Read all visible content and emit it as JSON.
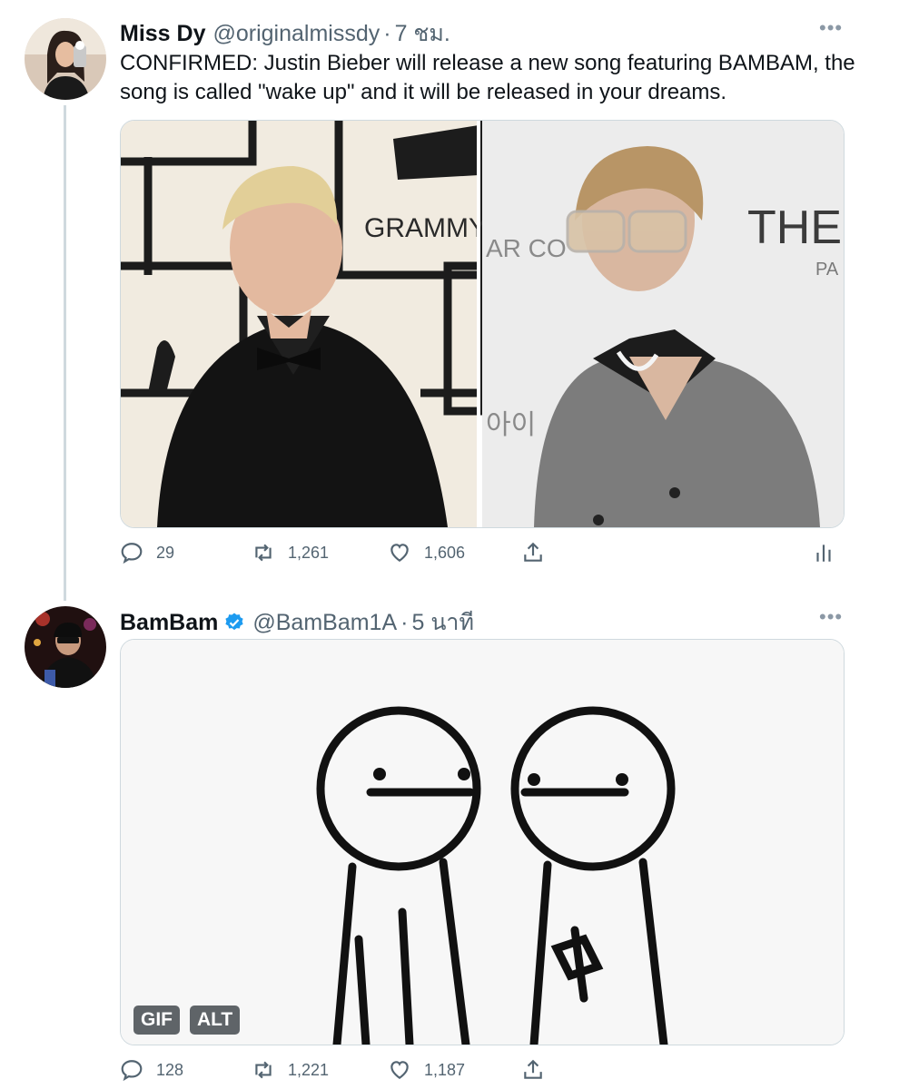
{
  "tweets": [
    {
      "name": "Miss Dy",
      "handle": "@originalmissdy",
      "time": "7 ชม.",
      "text": "CONFIRMED: Justin Bieber will release a new song featuring BAMBAM, the song is called \"wake up\" and it will be released in your dreams.",
      "media_left_sign": "GRAMMY A",
      "media_right_sign": "AR CO",
      "media_right_sign2": "THE",
      "media_right_sign3": "PA",
      "media_right_sign4": "아이",
      "stats": {
        "replies": "29",
        "retweets": "1,261",
        "likes": "1,606"
      }
    },
    {
      "name": "BamBam",
      "handle": "@BamBam1A",
      "time": "5 นาที",
      "badges": [
        "GIF",
        "ALT"
      ],
      "stats": {
        "replies": "128",
        "retweets": "1,221",
        "likes": "1,187"
      }
    }
  ],
  "icons": {
    "more": "more-icon",
    "reply": "reply-icon",
    "retweet": "retweet-icon",
    "like": "heart-icon",
    "share": "share-icon",
    "analytics": "analytics-icon",
    "verified": "verified-badge-icon"
  },
  "colors": {
    "verified": "#1d9bf0",
    "secondary_text": "#536471",
    "border": "#cfd9de"
  }
}
